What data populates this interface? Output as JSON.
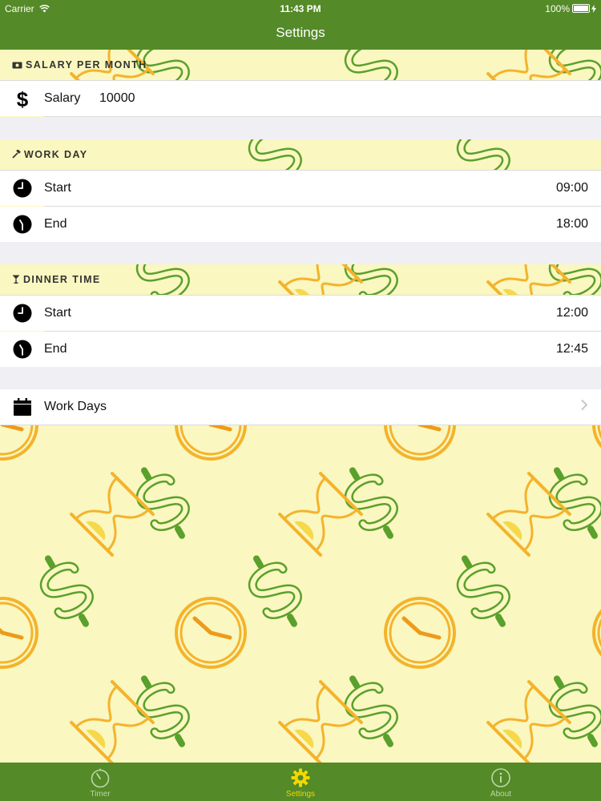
{
  "status_bar": {
    "carrier": "Carrier",
    "time": "11:43 PM",
    "battery": "100%"
  },
  "nav": {
    "title": "Settings"
  },
  "salary_section": {
    "header": "SALARY PER MONTH",
    "label": "Salary",
    "value": "10000"
  },
  "work_day": {
    "header": "WORK DAY",
    "start_label": "Start",
    "start_value": "09:00",
    "end_label": "End",
    "end_value": "18:00"
  },
  "dinner_time": {
    "header": "DINNER TIME",
    "start_label": "Start",
    "start_value": "12:00",
    "end_label": "End",
    "end_value": "12:45"
  },
  "work_days": {
    "label": "Work Days"
  },
  "tabs": [
    {
      "label": "Timer",
      "icon": "timer-icon",
      "active": false
    },
    {
      "label": "Settings",
      "icon": "gear-icon",
      "active": true
    },
    {
      "label": "About",
      "icon": "info-icon",
      "active": false
    }
  ],
  "colors": {
    "bar_green": "#548a27",
    "tab_active": "#f1d800",
    "pattern_bg": "#faf7c0",
    "pattern_green": "#5aa02c",
    "pattern_orange": "#f4b32c"
  },
  "background_icons": [
    "dollar-icon",
    "hourglass-icon",
    "clock-icon"
  ]
}
